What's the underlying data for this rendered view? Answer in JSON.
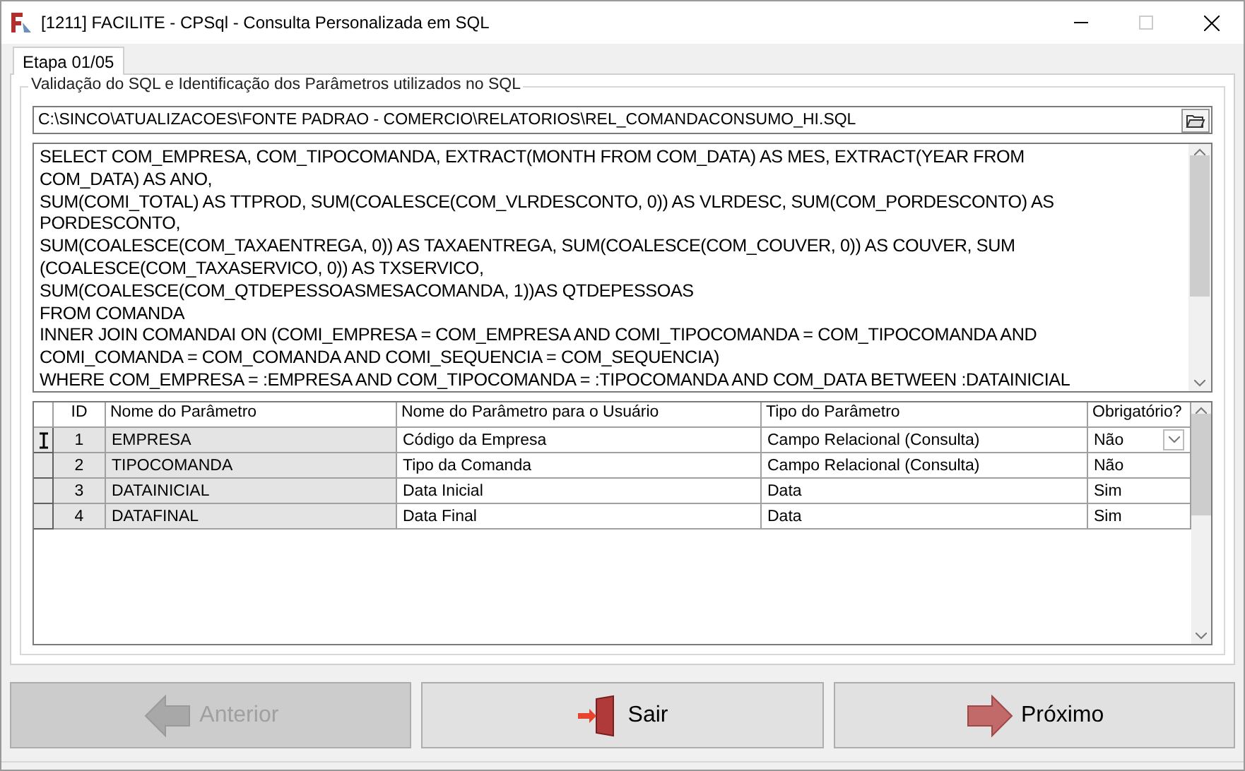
{
  "window": {
    "title": "[1211] FACILITE - CPSql - Consulta Personalizada em SQL"
  },
  "tabs": [
    {
      "label": "Etapa 01/05",
      "selected": true
    }
  ],
  "group": {
    "title": "Validação do SQL e Identificação dos Parâmetros utilizados no SQL"
  },
  "file_path": {
    "value": "C:\\SINCO\\ATUALIZACOES\\FONTE PADRAO - COMERCIO\\RELATORIOS\\REL_COMANDACONSUMO_HI.SQL"
  },
  "sql_lines": [
    "SELECT COM_EMPRESA, COM_TIPOCOMANDA, EXTRACT(MONTH FROM COM_DATA) AS MES, EXTRACT(YEAR FROM",
    "COM_DATA) AS ANO,",
    "SUM(COMI_TOTAL) AS TTPROD, SUM(COALESCE(COM_VLRDESCONTO, 0)) AS VLRDESC, SUM(COM_PORDESCONTO) AS",
    "PORDESCONTO,",
    "SUM(COALESCE(COM_TAXAENTREGA, 0)) AS TAXAENTREGA, SUM(COALESCE(COM_COUVER, 0)) AS COUVER, SUM",
    "(COALESCE(COM_TAXASERVICO, 0)) AS TXSERVICO,",
    "SUM(COALESCE(COM_QTDEPESSOASMESACOMANDA, 1))AS QTDEPESSOAS",
    "FROM COMANDA",
    "INNER JOIN COMANDAI ON (COMI_EMPRESA = COM_EMPRESA AND COMI_TIPOCOMANDA = COM_TIPOCOMANDA AND",
    "COMI_COMANDA = COM_COMANDA AND COMI_SEQUENCIA = COM_SEQUENCIA)",
    "WHERE COM_EMPRESA = :EMPRESA AND COM_TIPOCOMANDA = :TIPOCOMANDA AND COM_DATA BETWEEN :DATAINICIAL"
  ],
  "table": {
    "columns": [
      "ID",
      "Nome do Parâmetro",
      "Nome do Parâmetro para o Usuário",
      "Tipo do Parâmetro",
      "Obrigatório?"
    ],
    "rows": [
      {
        "selected": true,
        "cells": [
          "1",
          "EMPRESA",
          "Código da Empresa",
          "Campo Relacional (Consulta)",
          "Não"
        ]
      },
      {
        "selected": false,
        "cells": [
          "2",
          "TIPOCOMANDA",
          "Tipo da Comanda",
          "Campo Relacional (Consulta)",
          "Não"
        ]
      },
      {
        "selected": false,
        "cells": [
          "3",
          "DATAINICIAL",
          "Data Inicial",
          "Data",
          "Sim"
        ]
      },
      {
        "selected": false,
        "cells": [
          "4",
          "DATAFINAL",
          "Data Final",
          "Data",
          "Sim"
        ]
      }
    ]
  },
  "buttons": [
    {
      "kind": "back",
      "label": "Anterior",
      "disabled": true
    },
    {
      "kind": "exit",
      "label": "Sair",
      "disabled": false
    },
    {
      "kind": "next",
      "label": "Próximo",
      "disabled": false
    }
  ]
}
